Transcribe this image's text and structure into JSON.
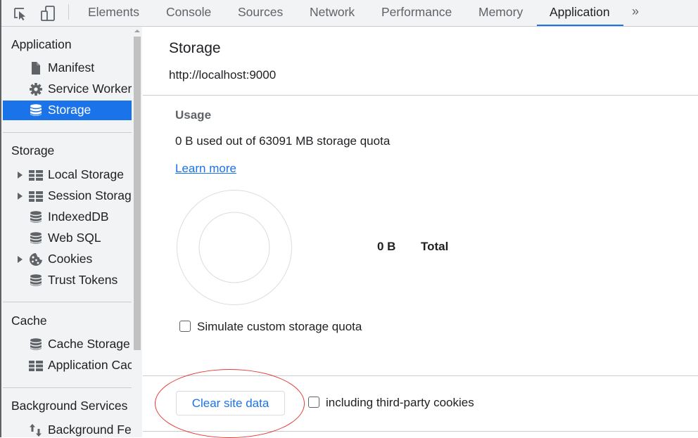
{
  "toolbar": {
    "inspect_icon": "inspect-element-icon",
    "device_icon": "device-toolbar-icon",
    "tabs": [
      {
        "label": "Elements",
        "active": false
      },
      {
        "label": "Console",
        "active": false
      },
      {
        "label": "Sources",
        "active": false
      },
      {
        "label": "Network",
        "active": false
      },
      {
        "label": "Performance",
        "active": false
      },
      {
        "label": "Memory",
        "active": false
      },
      {
        "label": "Application",
        "active": true
      }
    ],
    "more_label": "»",
    "accent_color": "#1a73e8"
  },
  "sidebar": {
    "sections": [
      {
        "title": "Application",
        "items": [
          {
            "label": "Manifest",
            "icon": "document-icon",
            "expandable": false,
            "selected": false
          },
          {
            "label": "Service Workers",
            "icon": "gear-icon",
            "expandable": false,
            "selected": false
          },
          {
            "label": "Storage",
            "icon": "database-icon",
            "expandable": false,
            "selected": true
          }
        ]
      },
      {
        "title": "Storage",
        "items": [
          {
            "label": "Local Storage",
            "icon": "table-icon",
            "expandable": true
          },
          {
            "label": "Session Storage",
            "icon": "table-icon",
            "expandable": true
          },
          {
            "label": "IndexedDB",
            "icon": "database-icon",
            "expandable": false
          },
          {
            "label": "Web SQL",
            "icon": "database-icon",
            "expandable": false
          },
          {
            "label": "Cookies",
            "icon": "cookie-icon",
            "expandable": true
          },
          {
            "label": "Trust Tokens",
            "icon": "database-icon",
            "expandable": false
          }
        ]
      },
      {
        "title": "Cache",
        "items": [
          {
            "label": "Cache Storage",
            "icon": "database-icon",
            "expandable": false
          },
          {
            "label": "Application Cache",
            "icon": "table-icon",
            "expandable": false
          }
        ]
      },
      {
        "title": "Background Services",
        "items": [
          {
            "label": "Background Fetch",
            "icon": "up-down-arrows-icon",
            "expandable": false
          }
        ]
      }
    ]
  },
  "main": {
    "title": "Storage",
    "origin": "http://localhost:9000",
    "usage": {
      "heading": "Usage",
      "summary": "0 B used out of 63091 MB storage quota",
      "learn_more": "Learn more"
    },
    "pie": {
      "total_value": "0 B",
      "total_label": "Total",
      "used_fraction": 0
    },
    "simulate_quota": {
      "label": "Simulate custom storage quota",
      "checked": false
    },
    "clear_button": "Clear site data",
    "third_party": {
      "label": "including third-party cookies",
      "checked": false
    },
    "annotation_color": "#e53935"
  }
}
